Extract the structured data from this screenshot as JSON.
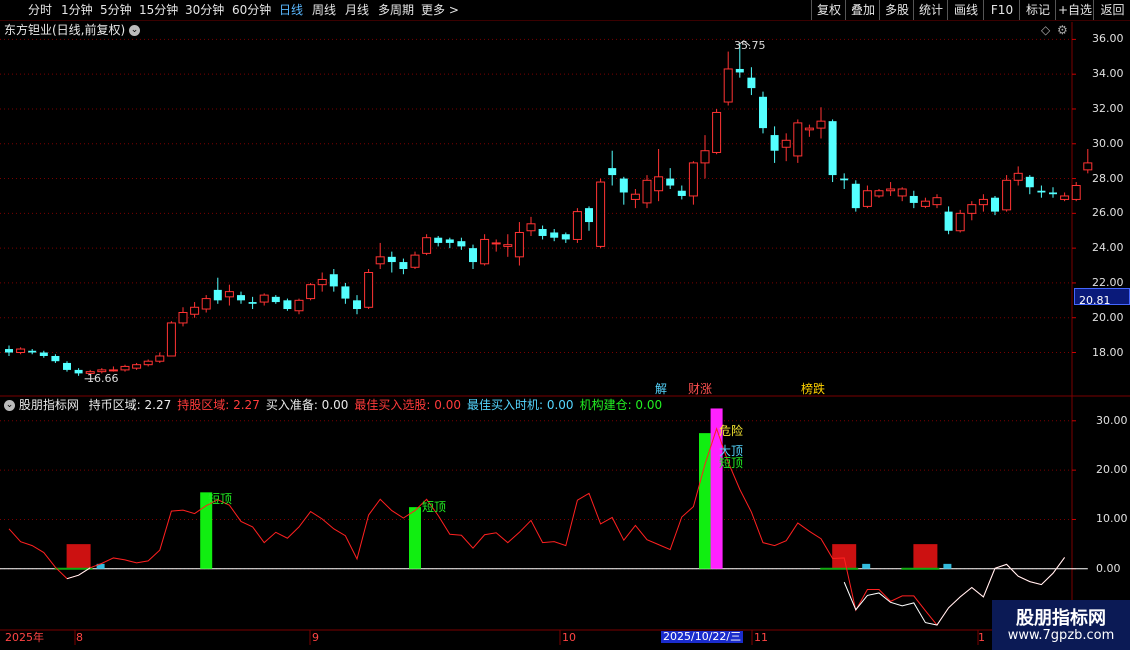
{
  "toolbar": {
    "periods": [
      "分时",
      "1分钟",
      "5分钟",
      "15分钟",
      "30分钟",
      "60分钟",
      "日线",
      "周线",
      "月线",
      "多周期",
      "更多 >"
    ],
    "active": "日线",
    "right_buttons": [
      "复权",
      "叠加",
      "多股",
      "统计",
      "画线",
      "F10",
      "标记",
      "+自选",
      "返回"
    ]
  },
  "stock": {
    "title": "东方钽业(日线,前复权)",
    "high_label": "35.75",
    "low_label": "16.66",
    "current_price": "20.81",
    "price_ticks": [
      "36.00",
      "34.00",
      "32.00",
      "30.00",
      "28.00",
      "26.00",
      "24.00",
      "22.00",
      "20.00",
      "18.00"
    ],
    "event_markers": [
      "解",
      "财涨",
      "榜跌"
    ]
  },
  "indicator": {
    "name": "股朋指标网",
    "items": [
      {
        "label": "持币区域:",
        "value": "2.27",
        "color": "#e8e8e8"
      },
      {
        "label": "持股区域:",
        "value": "2.27",
        "color": "#ff3b3b"
      },
      {
        "label": "买入准备:",
        "value": "0.00",
        "color": "#e8e8e8"
      },
      {
        "label": "最佳买入选股:",
        "value": "0.00",
        "color": "#ff3b3b"
      },
      {
        "label": "最佳买入时机:",
        "value": "0.00",
        "color": "#55d6ff"
      },
      {
        "label": "机构建仓:",
        "value": "0.00",
        "color": "#22ee22"
      }
    ],
    "ticks": [
      "30.00",
      "20.00",
      "10.00",
      "0.00"
    ],
    "annotations": [
      "短顶",
      "短顶",
      "危险",
      "大顶",
      "短顶"
    ]
  },
  "date_axis": {
    "labels": [
      "2025年",
      "8",
      "9",
      "10",
      "2025/10/22/三",
      "11",
      "1"
    ]
  },
  "watermark": {
    "title": "股朋指标网",
    "url": "www.7gpzb.com"
  },
  "colors": {
    "up": "#ff3333",
    "down": "#54ffff",
    "active_tab": "#5ab8ff",
    "grid": "#7a0000",
    "ma_line": "#ff2020",
    "green_bar": "#11ee11",
    "magenta_bar": "#ff22ff"
  },
  "chart_data": {
    "type": "candlestick",
    "ohlc": [
      [
        18.2,
        18.4,
        17.8,
        18.0
      ],
      [
        18.0,
        18.3,
        17.9,
        18.2
      ],
      [
        18.1,
        18.2,
        17.9,
        18.0
      ],
      [
        18.0,
        18.1,
        17.7,
        17.8
      ],
      [
        17.8,
        17.9,
        17.4,
        17.5
      ],
      [
        17.4,
        17.5,
        16.9,
        17.0
      ],
      [
        17.0,
        17.1,
        16.66,
        16.8
      ],
      [
        16.8,
        17.0,
        16.8,
        16.9
      ],
      [
        16.9,
        17.1,
        16.8,
        17.0
      ],
      [
        17.0,
        17.2,
        16.9,
        17.0
      ],
      [
        17.0,
        17.3,
        16.9,
        17.2
      ],
      [
        17.1,
        17.4,
        17.0,
        17.3
      ],
      [
        17.3,
        17.6,
        17.2,
        17.5
      ],
      [
        17.5,
        18.0,
        17.4,
        17.8
      ],
      [
        17.8,
        19.8,
        17.8,
        19.7
      ],
      [
        19.7,
        20.6,
        19.5,
        20.3
      ],
      [
        20.2,
        20.9,
        20.0,
        20.6
      ],
      [
        20.5,
        21.3,
        20.3,
        21.1
      ],
      [
        21.6,
        22.3,
        20.8,
        21.0
      ],
      [
        21.2,
        21.9,
        20.7,
        21.5
      ],
      [
        21.3,
        21.5,
        20.8,
        21.0
      ],
      [
        20.9,
        21.2,
        20.5,
        20.8
      ],
      [
        20.9,
        21.4,
        20.7,
        21.3
      ],
      [
        21.2,
        21.3,
        20.8,
        20.9
      ],
      [
        21.0,
        21.1,
        20.4,
        20.5
      ],
      [
        20.4,
        21.1,
        20.2,
        21.0
      ],
      [
        21.1,
        22.0,
        21.0,
        21.9
      ],
      [
        21.9,
        22.6,
        21.5,
        22.2
      ],
      [
        22.5,
        22.8,
        21.5,
        21.8
      ],
      [
        21.8,
        22.0,
        20.8,
        21.1
      ],
      [
        21.0,
        21.3,
        20.2,
        20.5
      ],
      [
        20.6,
        22.8,
        20.5,
        22.6
      ],
      [
        23.1,
        24.3,
        22.8,
        23.5
      ],
      [
        23.5,
        23.8,
        22.6,
        23.2
      ],
      [
        23.2,
        23.4,
        22.5,
        22.8
      ],
      [
        22.9,
        23.8,
        22.8,
        23.6
      ],
      [
        23.7,
        24.8,
        23.6,
        24.6
      ],
      [
        24.6,
        24.7,
        24.1,
        24.3
      ],
      [
        24.5,
        24.6,
        24.0,
        24.3
      ],
      [
        24.4,
        24.6,
        23.9,
        24.1
      ],
      [
        24.0,
        24.2,
        22.8,
        23.2
      ],
      [
        23.1,
        24.8,
        23.0,
        24.5
      ],
      [
        24.3,
        24.5,
        23.8,
        24.3
      ],
      [
        24.1,
        24.8,
        23.5,
        24.2
      ],
      [
        23.5,
        25.5,
        23.0,
        24.9
      ],
      [
        25.0,
        25.8,
        24.7,
        25.4
      ],
      [
        25.1,
        25.3,
        24.5,
        24.7
      ],
      [
        24.9,
        25.1,
        24.4,
        24.6
      ],
      [
        24.8,
        24.9,
        24.3,
        24.5
      ],
      [
        24.5,
        26.3,
        24.3,
        26.1
      ],
      [
        26.3,
        26.4,
        25.0,
        25.5
      ],
      [
        24.1,
        28.0,
        24.0,
        27.8
      ],
      [
        28.6,
        29.6,
        27.6,
        28.2
      ],
      [
        28.0,
        28.1,
        26.5,
        27.2
      ],
      [
        26.8,
        27.4,
        26.3,
        27.1
      ],
      [
        26.6,
        28.2,
        26.3,
        27.9
      ],
      [
        27.3,
        29.7,
        26.7,
        28.1
      ],
      [
        28.0,
        28.6,
        27.4,
        27.6
      ],
      [
        27.3,
        27.6,
        26.8,
        27.0
      ],
      [
        27.0,
        29.0,
        26.5,
        28.9
      ],
      [
        28.9,
        30.5,
        28.0,
        29.6
      ],
      [
        29.5,
        32.0,
        29.4,
        31.8
      ],
      [
        32.4,
        35.3,
        32.2,
        34.3
      ],
      [
        34.3,
        35.75,
        33.8,
        34.1
      ],
      [
        33.8,
        34.4,
        32.8,
        33.2
      ],
      [
        32.7,
        33.0,
        30.6,
        30.9
      ],
      [
        30.5,
        31.0,
        28.9,
        29.6
      ],
      [
        29.8,
        30.6,
        29.0,
        30.2
      ],
      [
        29.3,
        31.4,
        28.9,
        31.2
      ],
      [
        30.8,
        31.1,
        30.4,
        30.9
      ],
      [
        30.9,
        32.1,
        30.3,
        31.3
      ],
      [
        31.3,
        31.4,
        27.8,
        28.2
      ],
      [
        28.0,
        28.3,
        27.4,
        27.9
      ],
      [
        27.7,
        27.9,
        26.1,
        26.3
      ],
      [
        26.4,
        27.6,
        26.3,
        27.3
      ],
      [
        27.0,
        27.4,
        26.9,
        27.3
      ],
      [
        27.3,
        27.8,
        27.0,
        27.4
      ],
      [
        27.0,
        27.5,
        26.7,
        27.4
      ],
      [
        27.0,
        27.3,
        26.3,
        26.6
      ],
      [
        26.4,
        26.9,
        26.3,
        26.7
      ],
      [
        26.5,
        27.1,
        26.3,
        26.9
      ],
      [
        26.1,
        26.4,
        24.8,
        25.0
      ],
      [
        25.0,
        26.2,
        24.9,
        26.0
      ],
      [
        26.0,
        26.7,
        25.6,
        26.5
      ],
      [
        26.5,
        27.1,
        26.1,
        26.8
      ],
      [
        26.9,
        27.0,
        25.9,
        26.1
      ],
      [
        26.2,
        28.2,
        26.1,
        27.9
      ],
      [
        27.9,
        28.7,
        27.6,
        28.3
      ],
      [
        28.1,
        28.2,
        27.1,
        27.5
      ],
      [
        27.3,
        27.6,
        26.9,
        27.2
      ],
      [
        27.2,
        27.5,
        26.9,
        27.1
      ],
      [
        26.8,
        27.2,
        26.7,
        27.0
      ],
      [
        26.8,
        27.8,
        26.7,
        27.6
      ],
      [
        28.5,
        29.7,
        28.3,
        28.9
      ]
    ],
    "indicator_line": [
      8.1,
      5.5,
      4.7,
      3.3,
      0.3,
      -2.0,
      -1.3,
      0.2,
      1.1,
      2.2,
      1.8,
      1.2,
      1.6,
      3.8,
      11.7,
      11.9,
      11.2,
      12.8,
      14.0,
      12.9,
      9.6,
      8.5,
      5.3,
      7.4,
      6.2,
      8.5,
      11.6,
      10.1,
      8.1,
      6.7,
      2.0,
      10.9,
      14.1,
      11.8,
      10.3,
      11.8,
      14.1,
      10.8,
      7.0,
      6.8,
      4.2,
      6.9,
      7.3,
      5.3,
      7.4,
      9.8,
      5.3,
      5.5,
      4.7,
      13.9,
      15.3,
      9.1,
      10.4,
      5.8,
      8.8,
      5.9,
      4.9,
      3.9,
      10.5,
      12.6,
      21.2,
      28.4,
      21.6,
      16.1,
      11.5,
      5.3,
      4.7,
      5.7,
      9.3,
      7.6,
      6.1,
      2.1,
      2.2,
      -8.4,
      -4.2,
      -4.2,
      -6.6,
      -5.5,
      -5.5,
      -8.5,
      -11.4,
      -7.9,
      -5.7,
      -3.8,
      -5.7,
      0.1,
      0.9,
      -1.5,
      -2.6,
      -3.2,
      -0.9,
      2.3
    ],
    "indicator_line2": [
      null,
      null,
      null,
      null,
      null,
      -2.0,
      -1.3,
      0.2,
      null,
      null,
      null,
      null,
      null,
      null,
      null,
      null,
      null,
      null,
      null,
      null,
      null,
      null,
      null,
      null,
      null,
      null,
      null,
      null,
      null,
      null,
      null,
      null,
      null,
      null,
      null,
      null,
      null,
      null,
      null,
      null,
      null,
      null,
      null,
      null,
      null,
      null,
      null,
      null,
      null,
      null,
      null,
      null,
      null,
      null,
      null,
      null,
      null,
      null,
      null,
      null,
      null,
      null,
      null,
      null,
      null,
      null,
      null,
      null,
      null,
      null,
      null,
      null,
      -2.7,
      -8.3,
      -5.4,
      -4.9,
      -6.8,
      -7.5,
      -6.9,
      -10.9,
      -11.4,
      -7.9,
      -5.7,
      -3.8,
      -5.7,
      0.1,
      0.9,
      -1.5,
      -2.6,
      -3.2,
      -0.9,
      2.3
    ],
    "green_bars": [
      {
        "i": 17,
        "v": 15.5
      },
      {
        "i": 35,
        "v": 12.5
      },
      {
        "i": 60,
        "v": 27.5
      }
    ],
    "magenta_bars": [
      {
        "i": 61,
        "v": 32.5
      }
    ],
    "red_blocks": [
      {
        "i": 6,
        "v": 5.0
      },
      {
        "i": 72,
        "v": 5.0
      },
      {
        "i": 79,
        "v": 5.0
      }
    ],
    "ylim_price": [
      15.5,
      37.0
    ],
    "ylim_indicator": [
      -12,
      33
    ]
  }
}
